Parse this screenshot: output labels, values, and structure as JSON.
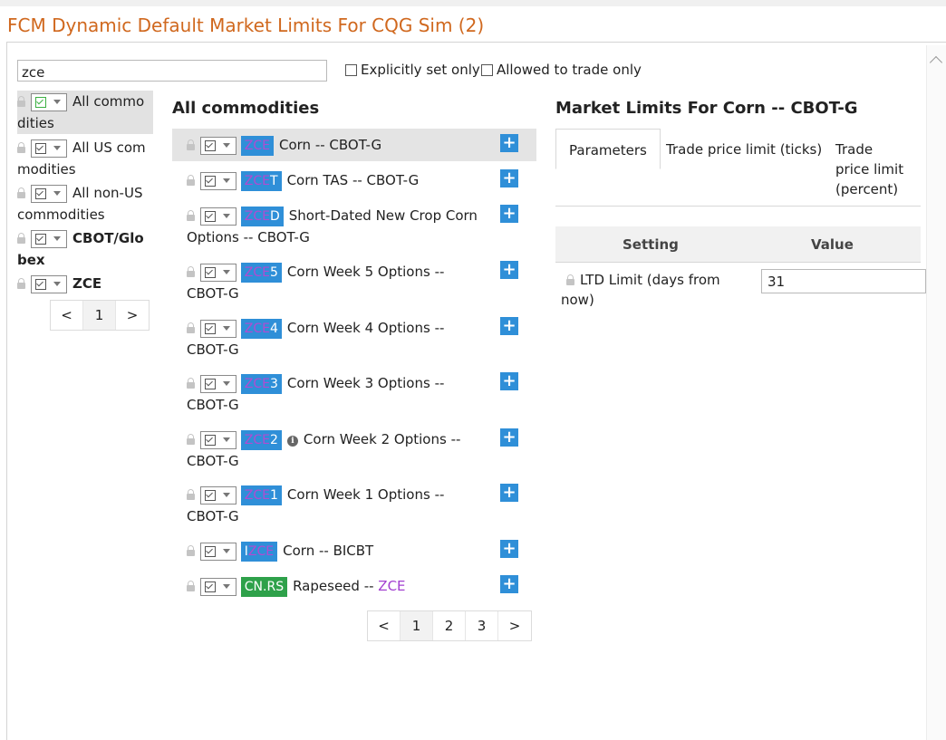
{
  "title": "FCM Dynamic Default Market Limits For CQG Sim (2)",
  "filter": {
    "search_value": "zce",
    "explicit_only_label": "Explicitly set only",
    "allowed_only_label": "Allowed to trade only"
  },
  "left": {
    "items": [
      {
        "line1": "All commo",
        "line2": "dities"
      },
      {
        "line1": "All US com",
        "line2": "modities"
      },
      {
        "line1": "All non-US",
        "line2": "commodities"
      },
      {
        "line1": "CBOT/Glo",
        "line2": "bex"
      },
      {
        "line1": "ZCE",
        "line2": ""
      }
    ],
    "pager": {
      "prev": "<",
      "page": "1",
      "next": ">"
    }
  },
  "middle": {
    "heading": "All commodities",
    "rows": [
      {
        "code": "ZCE",
        "suffix": "",
        "name": "Corn -- CBOT-G"
      },
      {
        "code": "ZCE",
        "suffix": "T",
        "name": "Corn TAS -- CBOT-G"
      },
      {
        "code": "ZCE",
        "suffix": "D",
        "name": "Short-Dated New Crop Corn Options -- CBOT-G"
      },
      {
        "code": "ZCE",
        "suffix": "5",
        "name": "Corn Week 5 Options -- CBOT-G"
      },
      {
        "code": "ZCE",
        "suffix": "4",
        "name": "Corn Week 4 Options -- CBOT-G"
      },
      {
        "code": "ZCE",
        "suffix": "3",
        "name": "Corn Week 3 Options -- CBOT-G"
      },
      {
        "code": "ZCE",
        "suffix": "2",
        "name": "Corn Week 2 Options -- CBOT-G"
      },
      {
        "code": "ZCE",
        "suffix": "1",
        "name": "Corn Week 1 Options -- CBOT-G"
      },
      {
        "prefix": "I",
        "code": "ZCE",
        "name": "Corn -- BICBT"
      },
      {
        "code": "CN.RS",
        "name": "Rapeseed -- ",
        "link": "ZCE"
      }
    ],
    "pager": [
      "<",
      "1",
      "2",
      "3",
      ">"
    ]
  },
  "right": {
    "heading": "Market Limits For Corn -- CBOT-G",
    "tabs": [
      "Parameters",
      "Trade price limit (ticks)",
      "Trade price limit (percent)"
    ],
    "columns": [
      "Setting",
      "Value"
    ],
    "setting_label": "LTD Limit (days from now)",
    "setting_value": "31"
  },
  "colors": {
    "title": "#d0681e",
    "tag": "#2f8fd8",
    "tag_green": "#2ea14a",
    "highlight": "#b24bd1"
  }
}
